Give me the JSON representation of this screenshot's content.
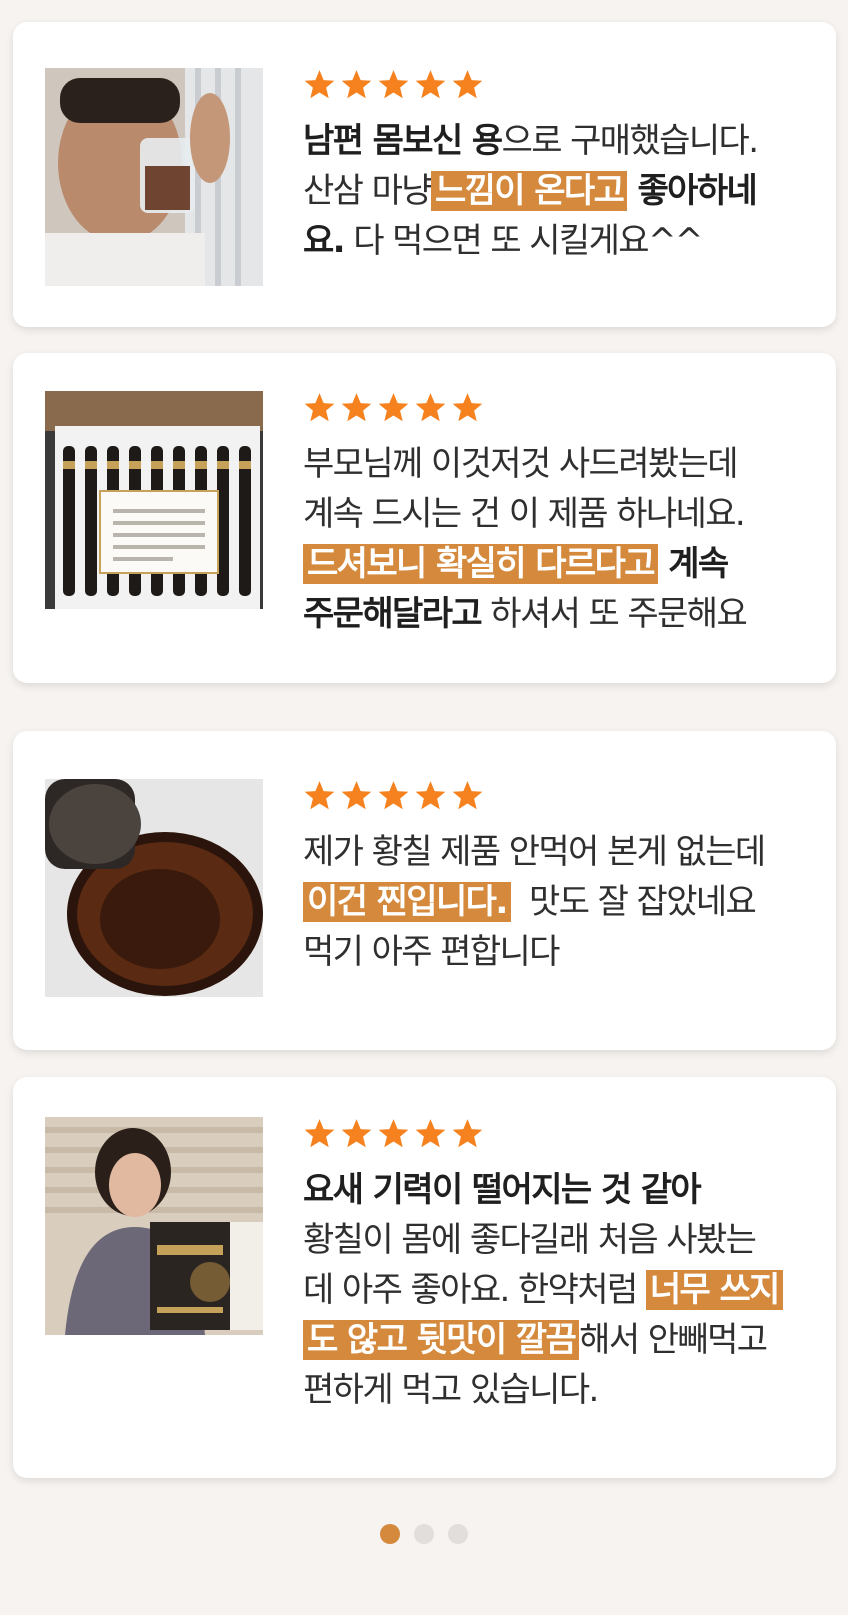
{
  "theme": {
    "accent": "#d4893c",
    "star_color": "#f5821f",
    "background": "#f6f3f0",
    "card_background": "#ffffff"
  },
  "reviews": [
    {
      "rating": 5,
      "image_alt": "man drinking dark liquid from glass",
      "parts": [
        {
          "t": "남편 몸보신 용",
          "s": "b"
        },
        {
          "t": "으로 구매했습니다.",
          "s": ""
        },
        {
          "t": "\n",
          "s": "br"
        },
        {
          "t": "산삼 마냥",
          "s": ""
        },
        {
          "t": "느낌이 온다고",
          "s": "hl"
        },
        {
          "t": " 좋아하네",
          "s": "b"
        },
        {
          "t": "\n",
          "s": "br"
        },
        {
          "t": "요.",
          "s": "b"
        },
        {
          "t": " 다 먹으면 또 시킬게요^^",
          "s": ""
        }
      ]
    },
    {
      "rating": 5,
      "image_alt": "gift box with vials and card",
      "parts": [
        {
          "t": "부모님께 이것저것 사드려봤는데",
          "s": ""
        },
        {
          "t": "\n",
          "s": "br"
        },
        {
          "t": "계속 드시는 건 이 제품 하나네요.",
          "s": ""
        },
        {
          "t": "\n",
          "s": "br"
        },
        {
          "t": "드셔보니 확실히 다르다고",
          "s": "hl"
        },
        {
          "t": " 계속",
          "s": "b"
        },
        {
          "t": "\n",
          "s": "br"
        },
        {
          "t": "주문해달라고",
          "s": "b"
        },
        {
          "t": " 하셔서 또 주문해요",
          "s": ""
        }
      ]
    },
    {
      "rating": 5,
      "image_alt": "dark liquid poured into glass",
      "parts": [
        {
          "t": "제가 황칠 제품 안먹어 본게 없는데",
          "s": ""
        },
        {
          "t": "\n",
          "s": "br"
        },
        {
          "t": "이건 찐입니다.",
          "s": "hl"
        },
        {
          "t": "  맛도 잘 잡았네요",
          "s": ""
        },
        {
          "t": "\n",
          "s": "br"
        },
        {
          "t": "먹기 아주 편합니다",
          "s": ""
        }
      ]
    },
    {
      "rating": 5,
      "image_alt": "woman holding product box",
      "parts": [
        {
          "t": "요새 기력이 떨어지는 것 같아",
          "s": "b"
        },
        {
          "t": "\n",
          "s": "br"
        },
        {
          "t": "황칠이 몸에 좋다길래 처음 사봤는",
          "s": ""
        },
        {
          "t": "\n",
          "s": "br"
        },
        {
          "t": "데 아주 좋아요. 한약처럼 ",
          "s": ""
        },
        {
          "t": "너무 쓰지",
          "s": "hl"
        },
        {
          "t": "\n",
          "s": "br"
        },
        {
          "t": "도 않고 뒷맛이 깔끔",
          "s": "hl"
        },
        {
          "t": "해서 안빼먹고",
          "s": ""
        },
        {
          "t": "\n",
          "s": "br"
        },
        {
          "t": "편하게 먹고 있습니다.",
          "s": ""
        }
      ]
    }
  ],
  "pagination": {
    "count": 3,
    "active": 0
  }
}
